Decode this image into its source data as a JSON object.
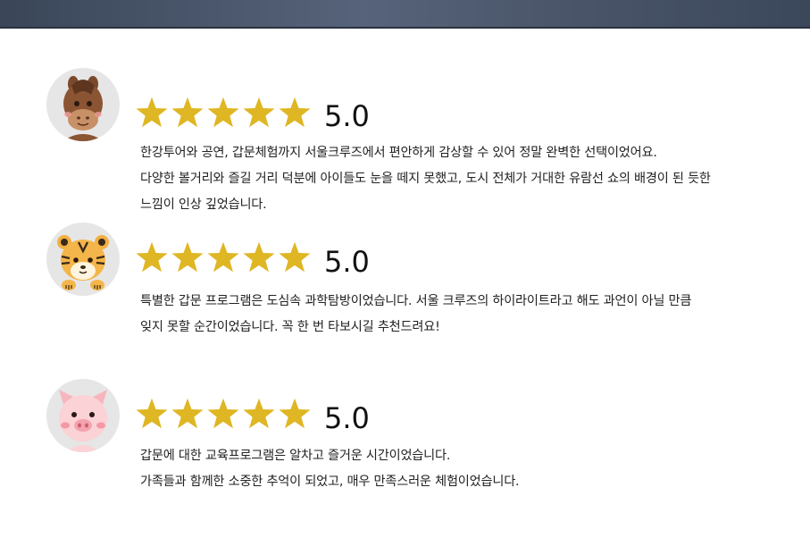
{
  "colors": {
    "star": "#dfb623",
    "banner": "#4a5569",
    "avatar_bg": "#e6e6e6"
  },
  "reviews": [
    {
      "avatar": "horse-avatar",
      "rating": "5.0",
      "stars": 5,
      "lines": [
        "한강투어와 공연, 갑문체험까지 서울크루즈에서 편안하게 감상할 수 있어 정말 완벽한 선택이었어요.",
        "다양한 볼거리와 즐길 거리 덕분에 아이들도 눈을 떼지 못했고, 도시 전체가 거대한 유람선 쇼의 배경이 된 듯한",
        "느낌이 인상 깊었습니다."
      ]
    },
    {
      "avatar": "tiger-avatar",
      "rating": "5.0",
      "stars": 5,
      "lines": [
        "특별한 갑문 프로그램은 도심속 과학탐방이었습니다. 서울 크루즈의 하이라이트라고 해도 과언이 아닐 만큼",
        "잊지 못할 순간이었습니다. 꼭 한 번 타보시길 추천드려요!"
      ]
    },
    {
      "avatar": "pig-avatar",
      "rating": "5.0",
      "stars": 5,
      "lines": [
        "갑문에 대한 교육프로그램은 알차고 즐거운 시간이었습니다.",
        "가족들과 함께한 소중한 추억이 되었고, 매우 만족스러운 체험이었습니다."
      ]
    }
  ]
}
